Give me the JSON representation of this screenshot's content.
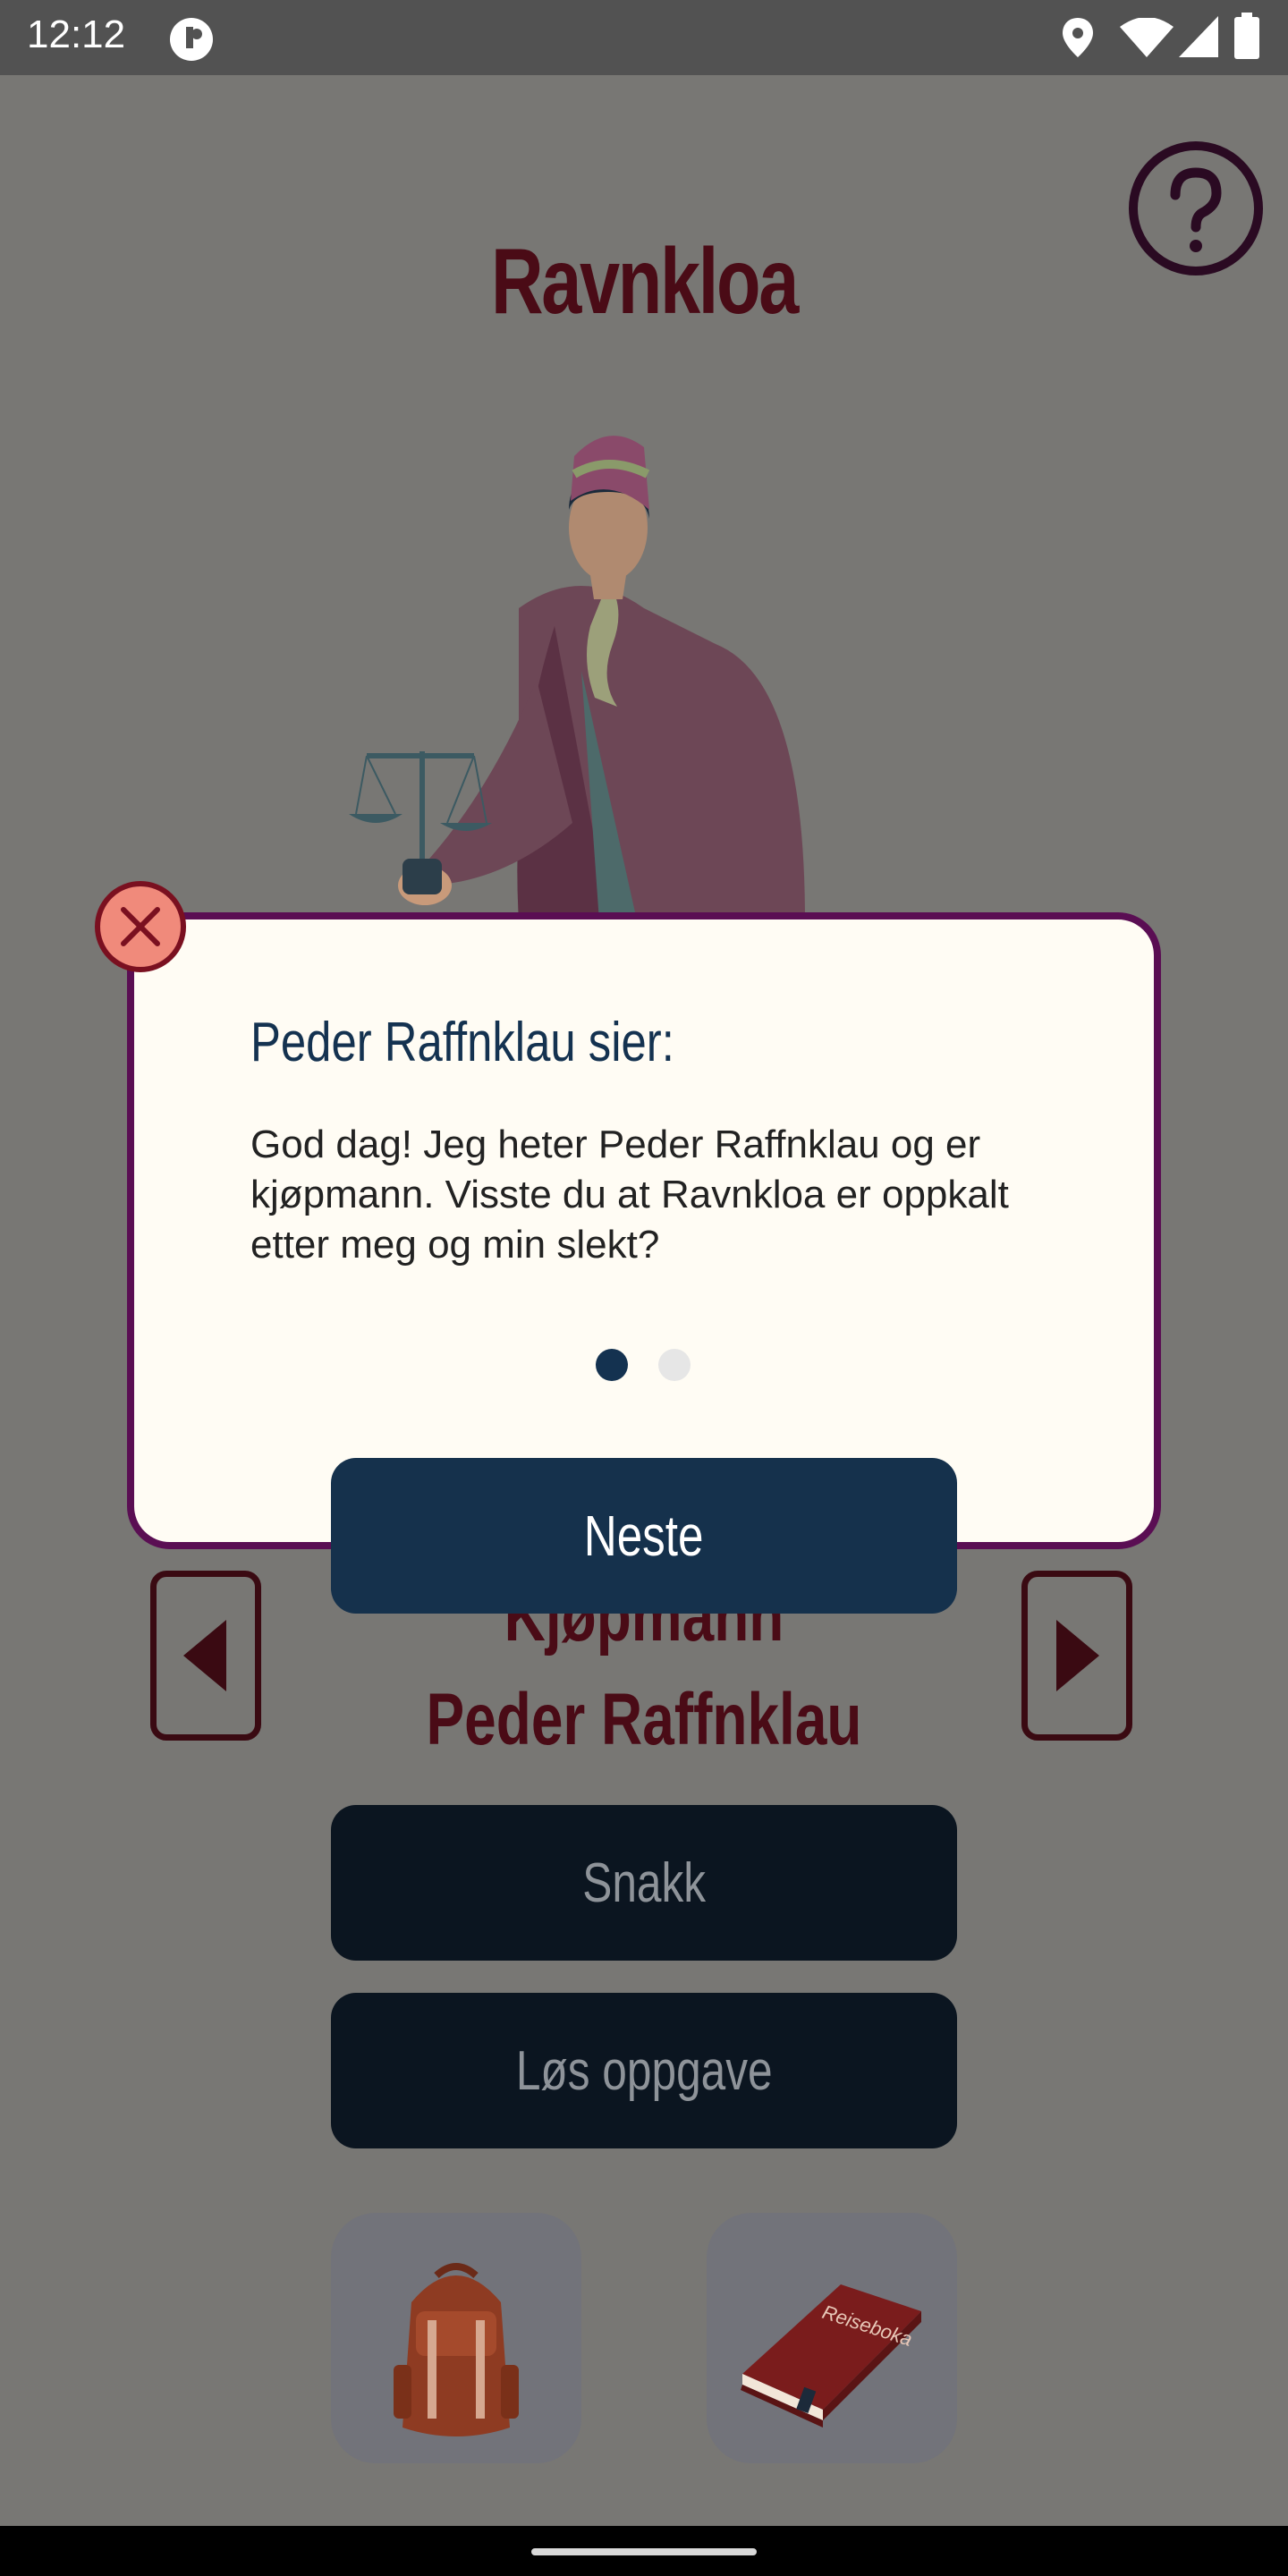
{
  "status_bar": {
    "time": "12:12"
  },
  "header": {
    "title": "Ravnkloa"
  },
  "character": {
    "role": "Kjøpmann",
    "name": "Peder Raffnklau"
  },
  "actions": {
    "talk_label": "Snakk",
    "task_label": "Løs oppgave"
  },
  "tiles": {
    "book_text": "Reiseboka"
  },
  "dialog": {
    "title": "Peder Raffnklau sier:",
    "text": "God dag! Jeg heter Peder Raffnklau og er kjøpmann. Visste du at Ravnkloa er oppkalt etter meg og min slekt?",
    "page_count": 2,
    "active_page": 0,
    "next_label": "Neste"
  },
  "colors": {
    "accent": "#15314c",
    "title": "#4a0b16",
    "dialog_border": "#5a0e53",
    "close": "#f08a7b"
  },
  "icons": [
    "location-icon",
    "wifi-icon",
    "signal-icon",
    "battery-icon",
    "help-icon",
    "close-icon",
    "arrow-left-icon",
    "arrow-right-icon",
    "backpack-icon",
    "book-icon"
  ]
}
